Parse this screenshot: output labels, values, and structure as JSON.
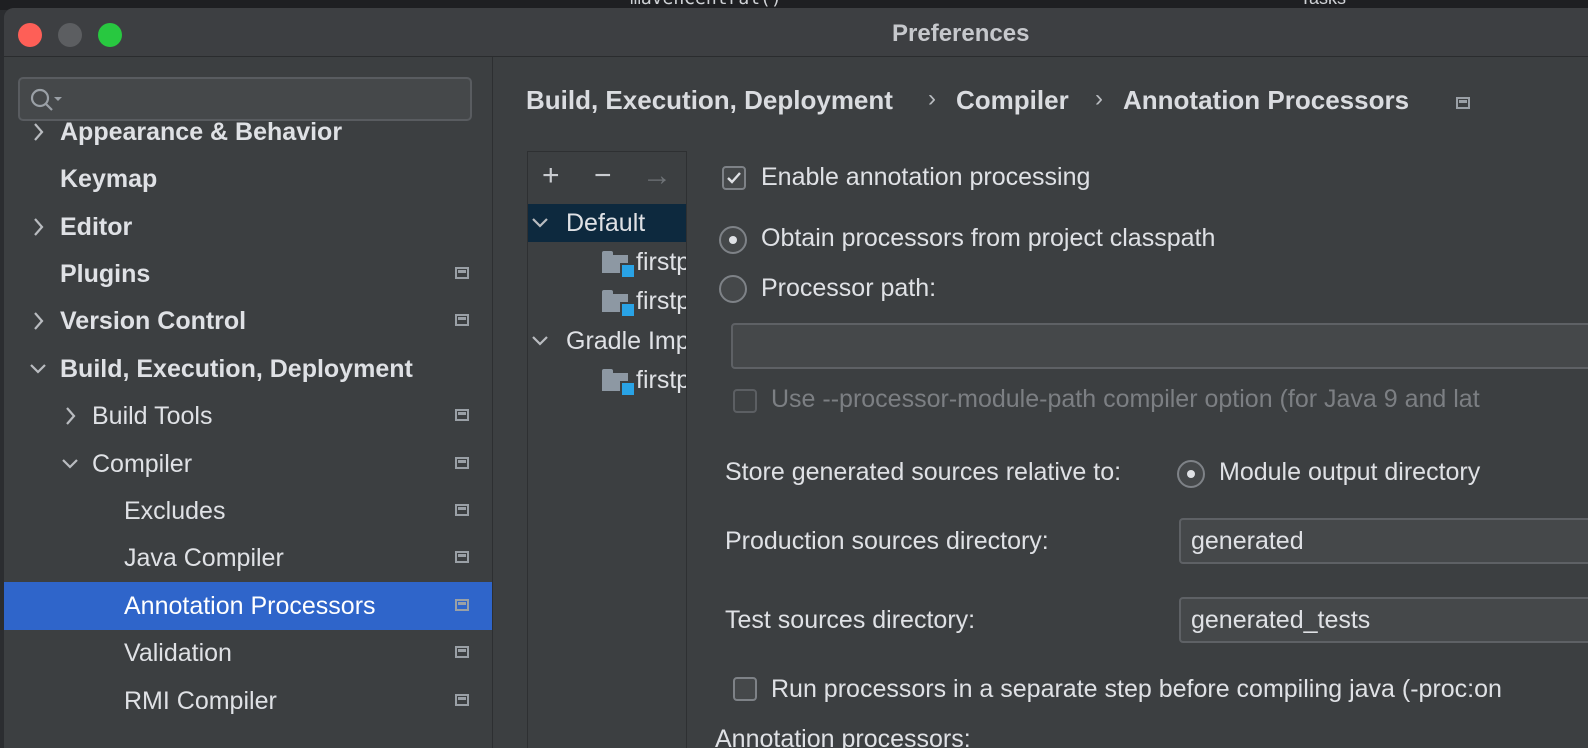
{
  "background": {
    "code_text": "mavenCentral()",
    "tree_text": "Tasks"
  },
  "window": {
    "title": "Preferences"
  },
  "search": {
    "placeholder": ""
  },
  "sidebar": {
    "items": [
      {
        "label": "Appearance & Behavior",
        "expandable": true,
        "expanded": false,
        "bold": true,
        "project_icon": false
      },
      {
        "label": "Keymap",
        "expandable": false,
        "bold": true,
        "project_icon": false
      },
      {
        "label": "Editor",
        "expandable": true,
        "expanded": false,
        "bold": true,
        "project_icon": false
      },
      {
        "label": "Plugins",
        "expandable": false,
        "bold": true,
        "project_icon": true
      },
      {
        "label": "Version Control",
        "expandable": true,
        "expanded": false,
        "bold": true,
        "project_icon": true
      },
      {
        "label": "Build, Execution, Deployment",
        "expandable": true,
        "expanded": true,
        "bold": true,
        "project_icon": false
      },
      {
        "label": "Build Tools",
        "expandable": true,
        "expanded": false,
        "bold": false,
        "project_icon": true
      },
      {
        "label": "Compiler",
        "expandable": true,
        "expanded": true,
        "bold": false,
        "project_icon": true
      },
      {
        "label": "Excludes",
        "expandable": false,
        "bold": false,
        "project_icon": true
      },
      {
        "label": "Java Compiler",
        "expandable": false,
        "bold": false,
        "project_icon": true
      },
      {
        "label": "Annotation Processors",
        "expandable": false,
        "bold": false,
        "project_icon": true,
        "selected": true
      },
      {
        "label": "Validation",
        "expandable": false,
        "bold": false,
        "project_icon": true
      },
      {
        "label": "RMI Compiler",
        "expandable": false,
        "bold": false,
        "project_icon": true
      }
    ]
  },
  "breadcrumb": {
    "parts": [
      "Build, Execution, Deployment",
      "Compiler",
      "Annotation Processors"
    ],
    "separator": "›"
  },
  "profiles": {
    "toolbar": {
      "add": "+",
      "remove": "−",
      "move": "→"
    },
    "rows": [
      {
        "label": "Default",
        "type": "group",
        "selected": true
      },
      {
        "label": "firstp",
        "type": "module"
      },
      {
        "label": "firstp",
        "type": "module"
      },
      {
        "label": "Gradle Imp",
        "type": "group"
      },
      {
        "label": "firstp",
        "type": "module"
      }
    ]
  },
  "options": {
    "enable_annotation_processing": {
      "label": "Enable annotation processing",
      "checked": true
    },
    "obtain_from_classpath": {
      "label": "Obtain processors from project classpath",
      "selected": true
    },
    "processor_path": {
      "label": "Processor path:",
      "selected": false,
      "value": ""
    },
    "module_path_option": {
      "label": "Use --processor-module-path compiler option (for Java 9 and lat",
      "checked": false,
      "enabled": false
    },
    "store_relative_label": "Store generated sources relative to:",
    "module_output_directory": {
      "label": "Module output directory",
      "selected": true
    },
    "production_sources": {
      "label": "Production sources directory:",
      "value": "generated"
    },
    "test_sources": {
      "label": "Test sources directory:",
      "value": "generated_tests"
    },
    "separate_step": {
      "label": "Run processors in a separate step before compiling java (-proc:on",
      "checked": false
    },
    "annotation_processors_label": "Annotation processors:"
  },
  "colors": {
    "accent": "#2f65ca",
    "panel": "#3c3f41",
    "profile_selected": "#0d293e"
  }
}
